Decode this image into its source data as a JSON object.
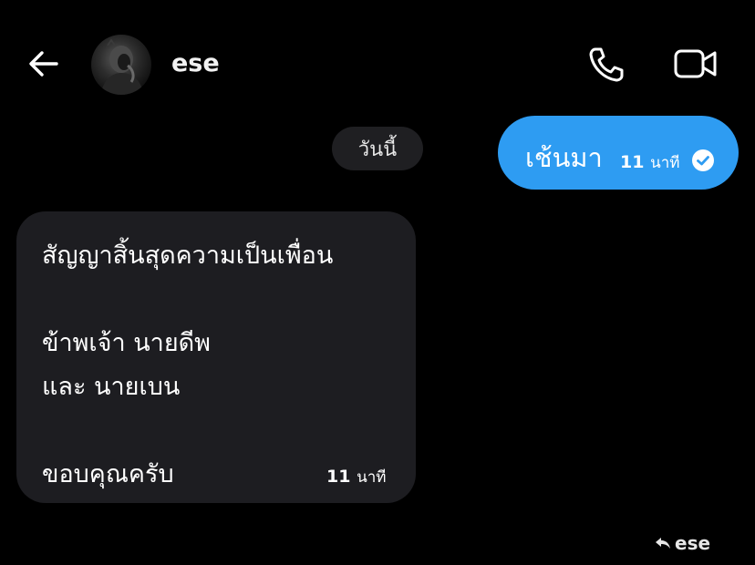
{
  "header": {
    "contact_name": "ese",
    "back_icon": "arrow-left-icon",
    "call_icon": "phone-icon",
    "video_icon": "video-camera-icon"
  },
  "date_chip": "วันนี้",
  "outgoing": {
    "text": "เช้นมา",
    "time_num": "11",
    "time_unit": "นาที",
    "status_icon": "read-check-icon",
    "color": "#2e9cf2"
  },
  "incoming": {
    "lines": [
      "สัญญาสิ้นสุดความเป็นเพื่อน",
      "ข้าพเจ้า นายดีพ",
      "และ นายเบน",
      "ขอบคุณครับ"
    ],
    "time_num": "11",
    "time_unit": "นาที",
    "color": "#1d1d21"
  },
  "reply_hint": {
    "icon": "reply-arrow-icon",
    "name": "ese"
  }
}
